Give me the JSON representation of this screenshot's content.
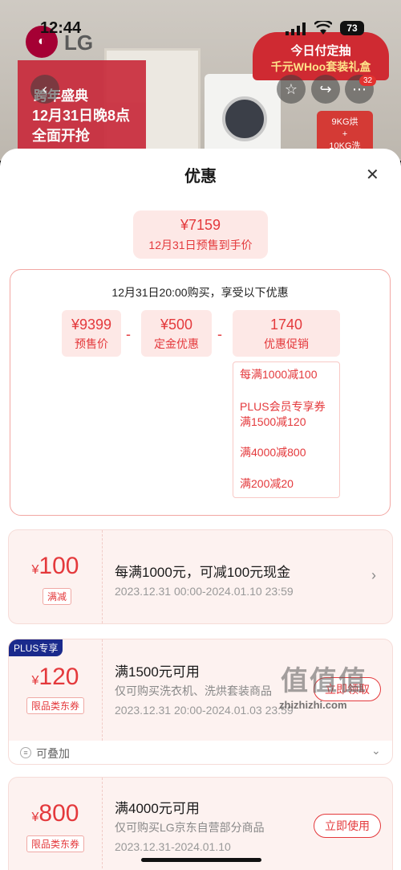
{
  "status_bar": {
    "time": "12:44",
    "battery": "73"
  },
  "background": {
    "brand": "LG",
    "left_banner": {
      "line1": "跨年盛典",
      "line2": "12月31日晚8点",
      "line3": "全面开抢"
    },
    "right_banner": {
      "line1": "今日付定抽",
      "line2": "千元WHoo套装礼盒"
    },
    "badge": {
      "line1": "9KG烘",
      "line2": "+",
      "line3": "10KG洗"
    },
    "cart_count": "32"
  },
  "sheet": {
    "title": "优惠",
    "final_price": {
      "amount": "¥7159",
      "label": "12月31日预售到手价"
    },
    "calc": {
      "heading": "12月31日20:00购买，享受以下优惠",
      "cells": [
        {
          "value": "¥9399",
          "label": "预售价"
        },
        {
          "value": "¥500",
          "label": "定金优惠"
        },
        {
          "value": "1740",
          "label": "优惠促销"
        }
      ],
      "operators": [
        "-",
        "-"
      ],
      "promos": [
        "每满1000减100",
        "PLUS会员专享券",
        "满1500减120",
        "满4000减800",
        "满200减20"
      ]
    },
    "coupons": [
      {
        "currency": "¥",
        "amount": "100",
        "tag": "满减",
        "title": "每满1000元，可减100元现金",
        "date": "2023.12.31 00:00-2024.01.10 23:59"
      },
      {
        "badge": "PLUS专享",
        "currency": "¥",
        "amount": "120",
        "tag": "限品类东券",
        "title": "满1500元可用",
        "subtitle": "仅可购买洗衣机、洗烘套装商品",
        "date": "2023.12.31 20:00-2024.01.03 23:59",
        "button": "立即领取"
      },
      {
        "currency": "¥",
        "amount": "800",
        "tag": "限品类东券",
        "title": "满4000元可用",
        "subtitle": "仅可购买LG京东自营部分商品",
        "date": "2023.12.31-2024.01.10",
        "button": "立即使用"
      }
    ],
    "stack_label": "可叠加"
  },
  "watermark": {
    "glyphs": "值值值",
    "site": "zhizhizhi.com"
  }
}
